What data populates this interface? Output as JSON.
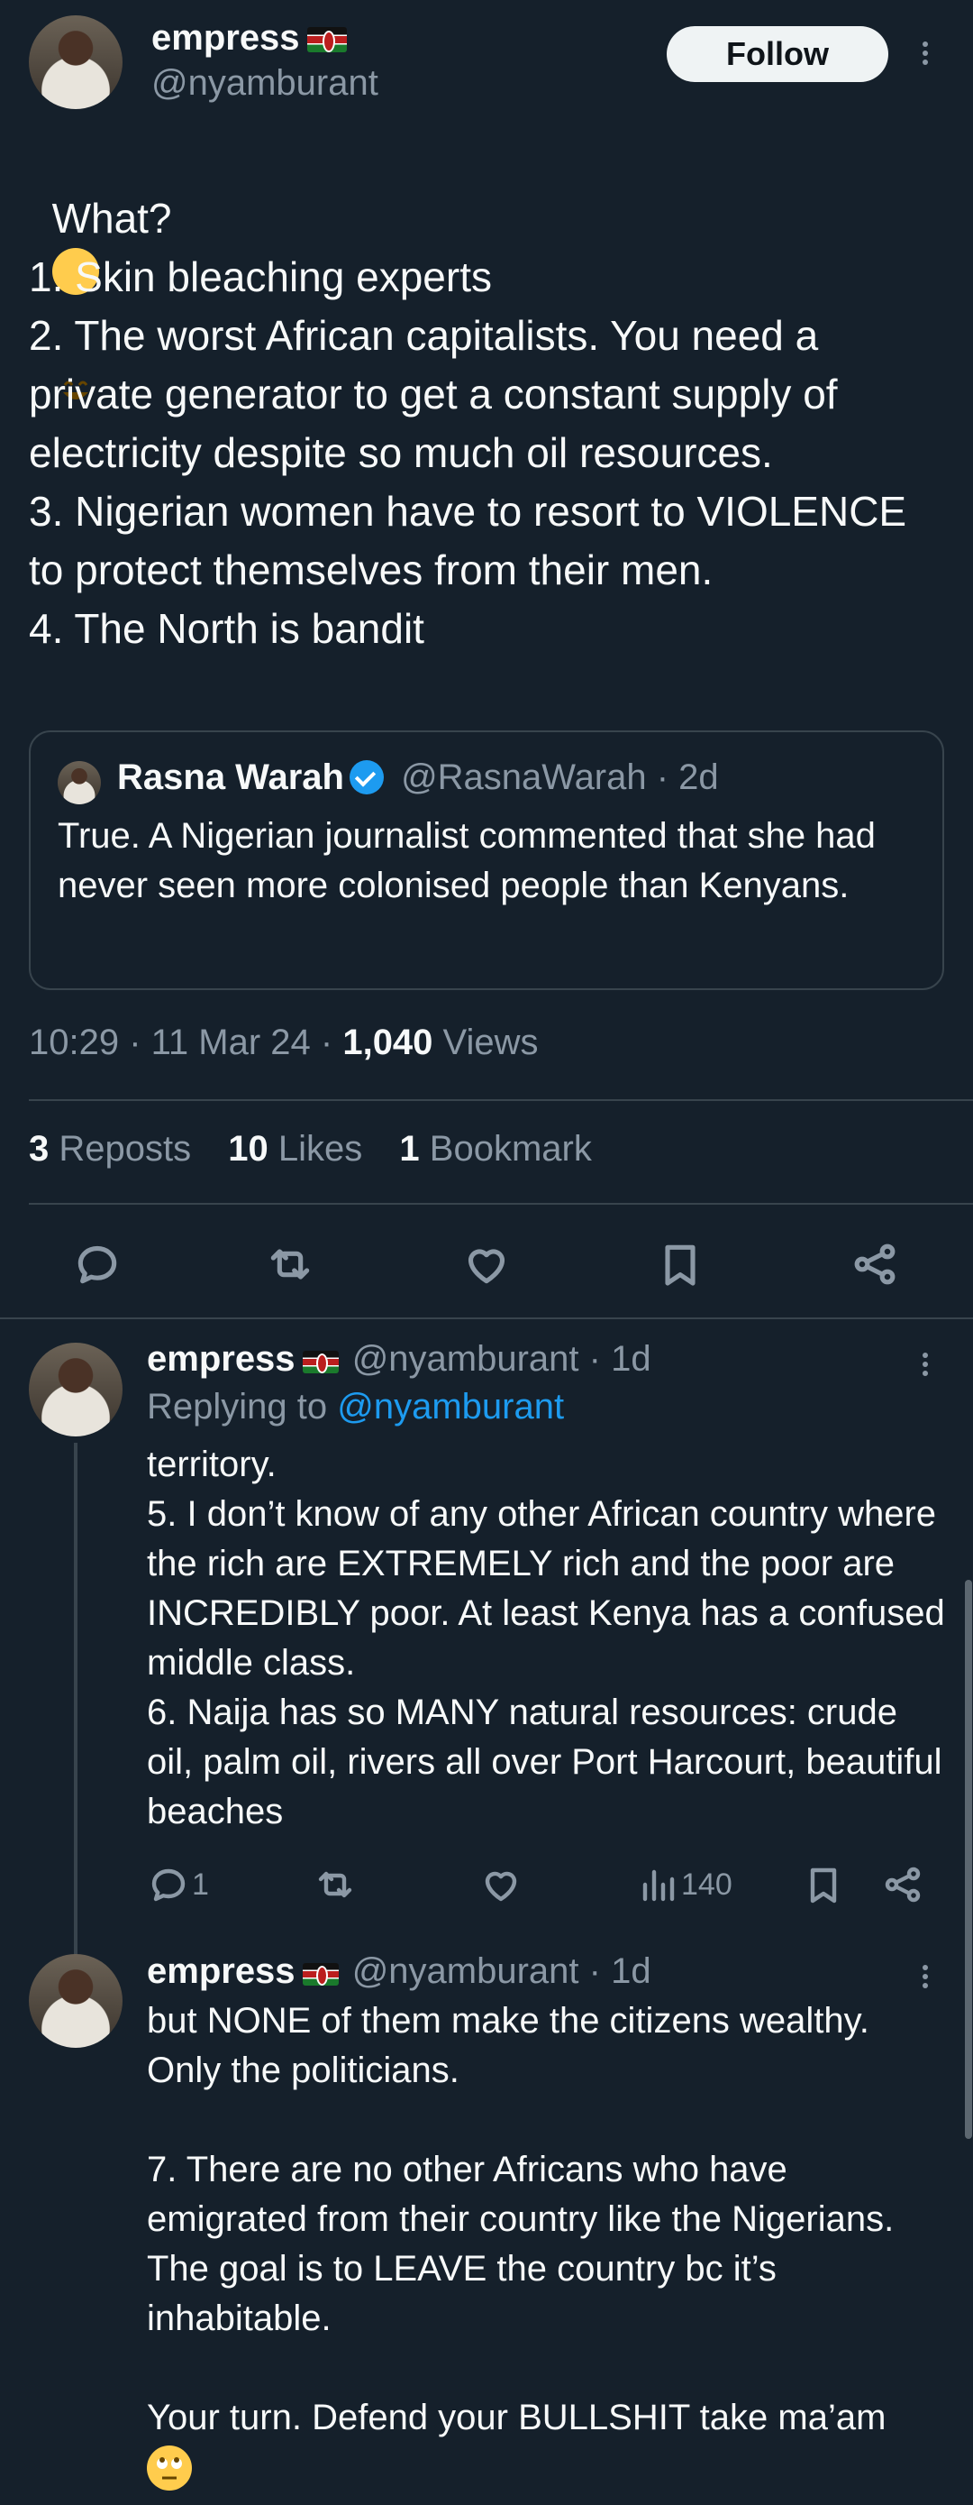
{
  "tweet": {
    "author_name": "empress",
    "author_handle": "@nyamburant",
    "follow_label": "Follow",
    "text_intro": "What?",
    "text_body": "1. Skin bleaching experts\n2. The worst African capitalists. You need a private generator to get a constant supply of electricity despite so much oil resources.\n3. Nigerian women have to resort to VIOLENCE to protect themselves from their men.\n4. The North is bandit",
    "quote": {
      "author_name": "Rasna Warah",
      "author_handle": "@RasnaWarah",
      "time": "· 2d",
      "text": "True. A Nigerian journalist commented that she had never seen more colonised people than Kenyans."
    },
    "timestamp": "10:29 · 11 Mar 24 · ",
    "views_count": "1,040",
    "views_label": " Views",
    "stats": {
      "reposts_count": "3",
      "reposts_label": "Reposts",
      "likes_count": "10",
      "likes_label": "Likes",
      "bookmarks_count": "1",
      "bookmarks_label": "Bookmark"
    }
  },
  "replies": [
    {
      "author_name": "empress",
      "author_handle": "@nyamburant",
      "time": "· 1d",
      "replying_prefix": "Replying to ",
      "replying_handle": "@nyamburant",
      "text": "territory.\n5. I don’t know of any other African country where the rich are EXTREMELY rich and the poor are INCREDIBLY poor. At least Kenya has a confused middle class.\n6. Naija has so MANY natural resources: crude oil, palm oil, rivers all over Port Harcourt, beautiful beaches",
      "reply_count": "1",
      "views_count": "140"
    },
    {
      "author_name": "empress",
      "author_handle": "@nyamburant",
      "time": "· 1d",
      "text": "but NONE of them make the citizens wealthy. Only the politicians.\n\n7. There are no other Africans who have emigrated from their country like the Nigerians. The goal is to LEAVE the country bc it’s inhabitable.\n\nYour turn. Defend your BULLSHIT take ma’am"
    }
  ],
  "icons": {
    "reply": "reply-icon",
    "repost": "repost-icon",
    "like": "heart-icon",
    "bookmark": "bookmark-icon",
    "share": "share-icon",
    "views": "views-icon",
    "more": "more-dots-icon",
    "verified": "verified-badge-icon",
    "flag": "kenya-flag-icon",
    "laugh_emoji": "rolling-laughing-emoji",
    "eyeroll_emoji": "eye-roll-emoji"
  },
  "colors": {
    "background": "#15202b",
    "text": "#f7f9f9",
    "muted": "#8b98a5",
    "accent": "#1d9bf0",
    "border": "#38444d"
  }
}
